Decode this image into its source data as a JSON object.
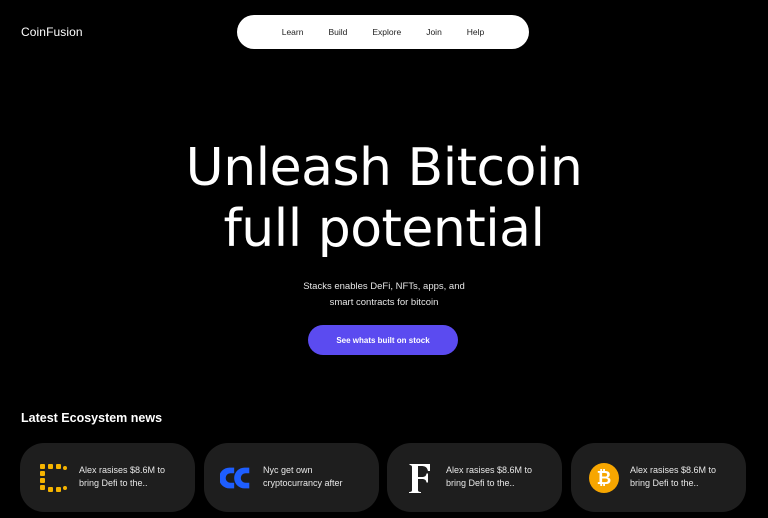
{
  "brand": {
    "name": "CoinFusion"
  },
  "nav": {
    "items": [
      {
        "label": "Learn"
      },
      {
        "label": "Build"
      },
      {
        "label": "Explore"
      },
      {
        "label": "Join"
      },
      {
        "label": "Help"
      }
    ]
  },
  "hero": {
    "title_line1": "Unleash Bitcoin",
    "title_line2": "full potential",
    "subtitle_line1": "Stacks enables DeFi, NFTs, apps, and",
    "subtitle_line2": "smart contracts for bitcoin",
    "cta_label": "See whats built on stock"
  },
  "news": {
    "title": "Latest Ecosystem news",
    "cards": [
      {
        "icon": "alex-logo-icon",
        "line1": "Alex rasises $8.6M to",
        "line2": "bring Defi to the.."
      },
      {
        "icon": "cc-logo-icon",
        "line1": "Nyc get own",
        "line2": "cryptocurrancy after"
      },
      {
        "icon": "f-logo-icon",
        "line1": "Alex rasises $8.6M to",
        "line2": "bring Defi to the.."
      },
      {
        "icon": "bitcoin-icon",
        "line1": "Alex rasises $8.6M to",
        "line2": "bring Defi to the.."
      }
    ]
  },
  "colors": {
    "background": "#000000",
    "accent": "#5b4bf0",
    "card_bg": "#1e1e1e",
    "alex_yellow": "#f5b400",
    "cc_blue": "#1e5eff",
    "bitcoin_orange": "#f7a600"
  }
}
